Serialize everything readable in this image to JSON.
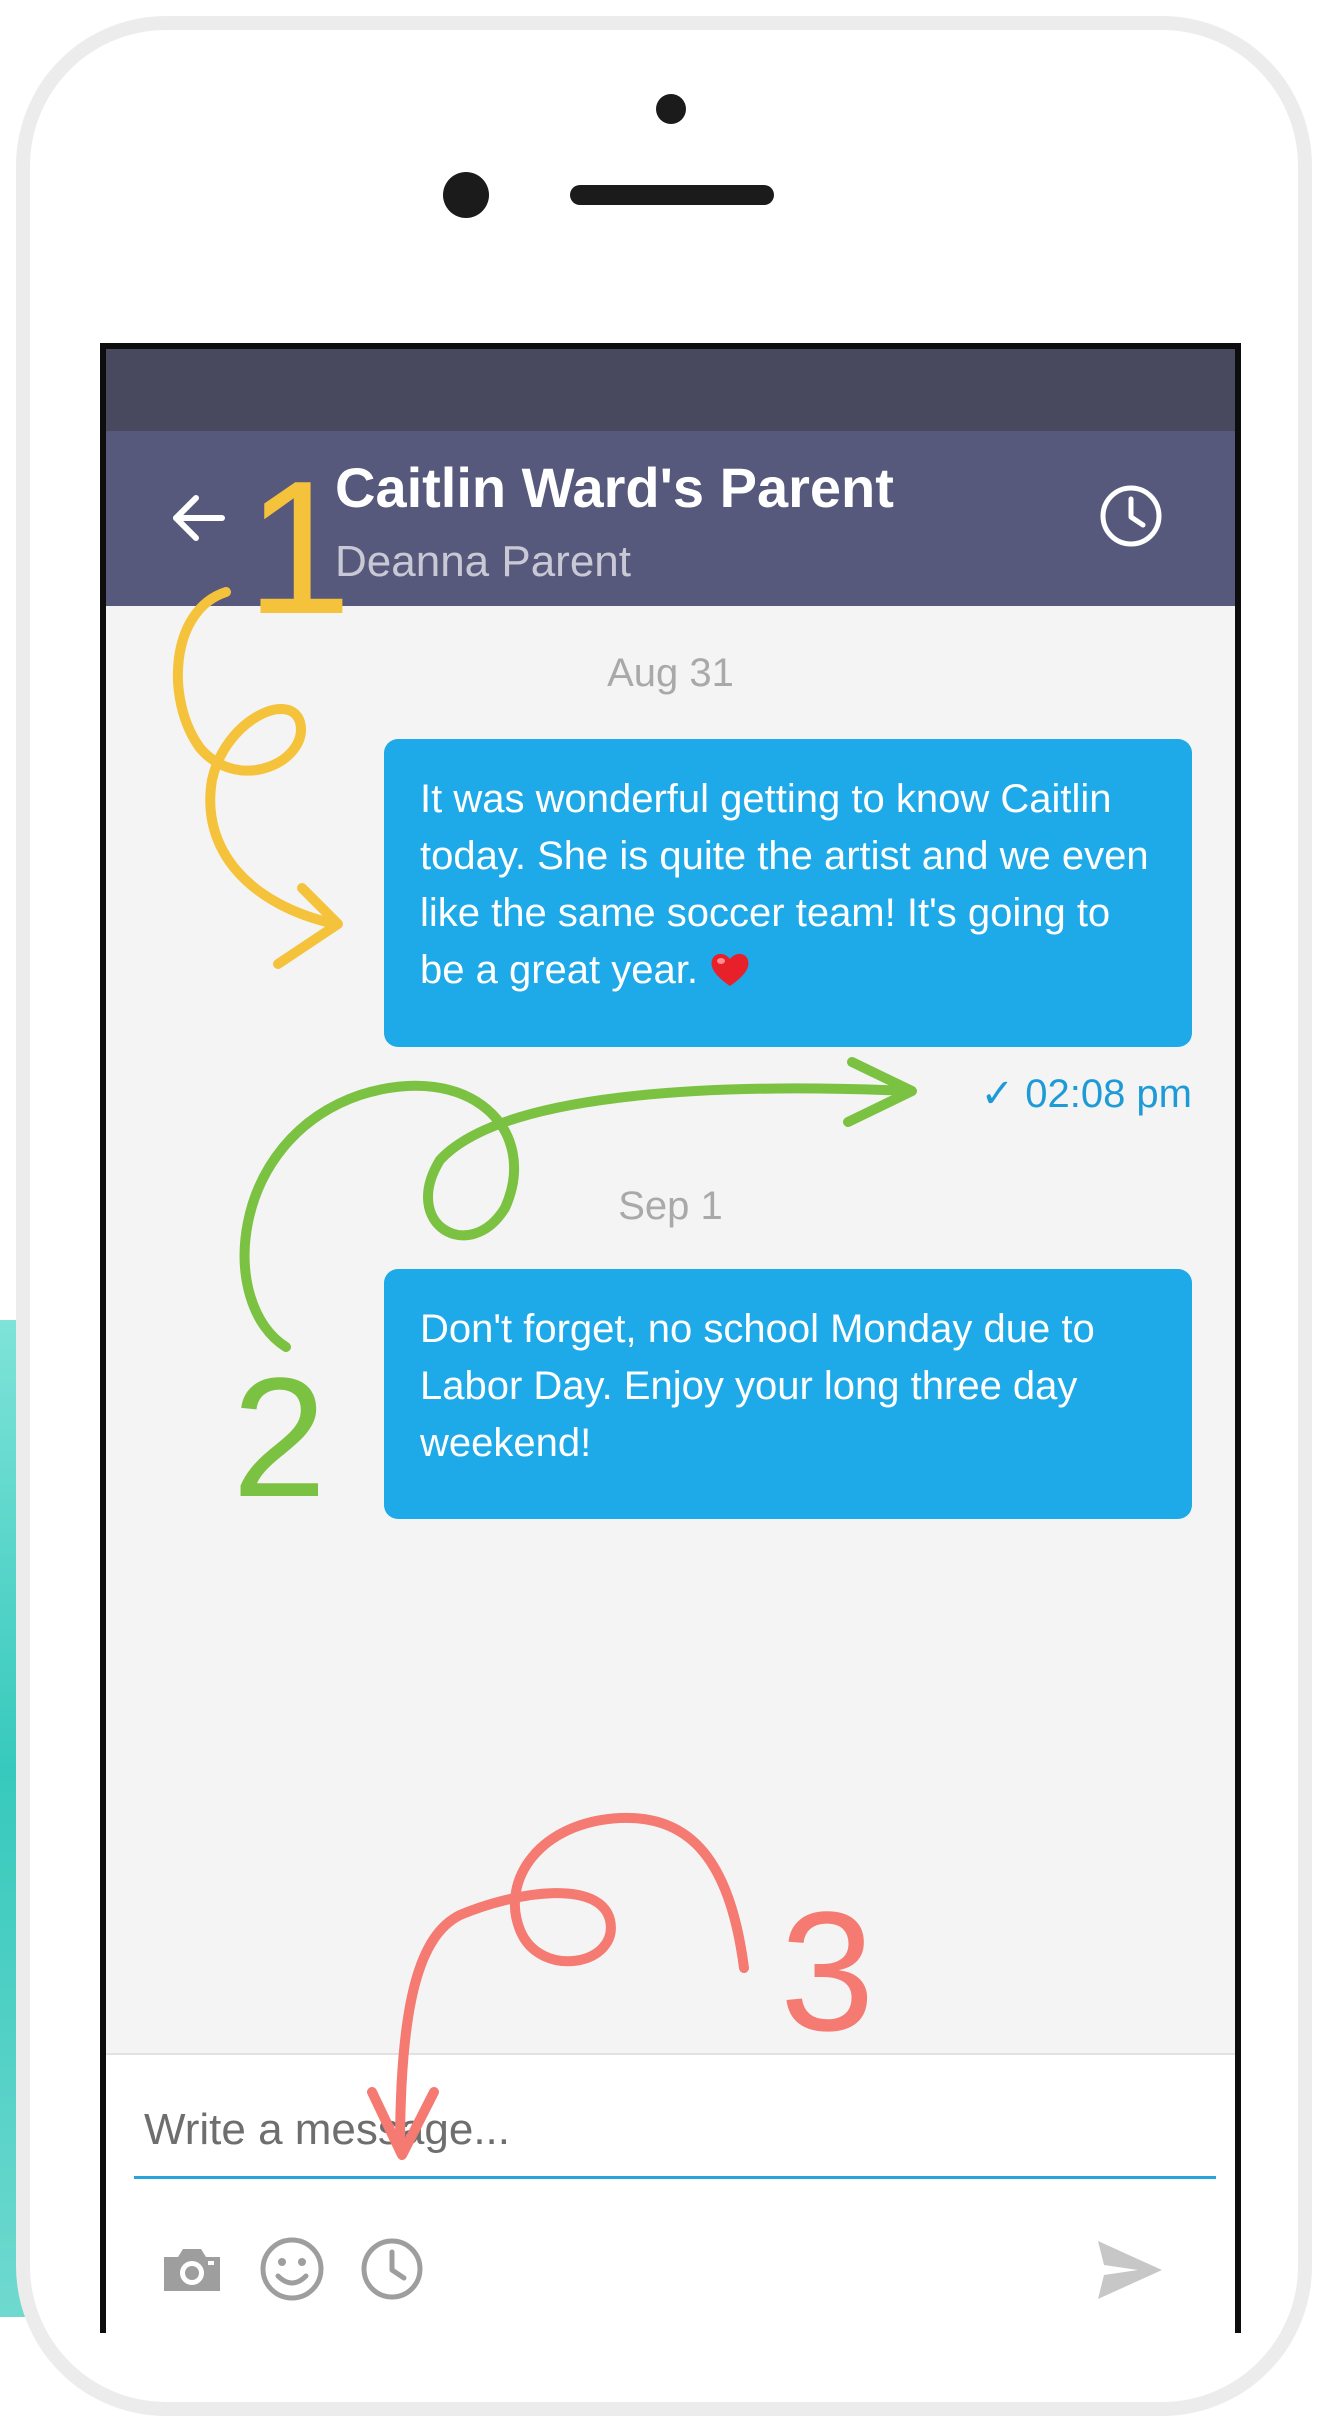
{
  "header": {
    "title": "Caitlin Ward's Parent",
    "subtitle": "Deanna Parent",
    "back_icon": "arrow-left-icon",
    "history_icon": "clock-icon"
  },
  "conversation": {
    "groups": [
      {
        "date": "Aug 31",
        "message": "It was wonderful getting to know Caitlin today. She is quite the artist and we even like the same soccer team! It's going to be a great year.",
        "emoji": "heart-emoji",
        "time": "✓ 02:08 pm"
      },
      {
        "date": "Sep 1",
        "message": "Don't forget, no school Monday due to Labor Day. Enjoy your long three day weekend!"
      }
    ]
  },
  "composer": {
    "placeholder": "Write a message...",
    "tools": [
      "camera-icon",
      "smiley-icon",
      "clock-icon"
    ],
    "send_icon": "send-icon"
  },
  "annotations": {
    "marks": [
      "1",
      "2",
      "3"
    ],
    "colors": {
      "mark_1": "#f5c33b",
      "mark_2": "#7cc242",
      "mark_3": "#f47a72"
    }
  },
  "colors": {
    "status_bar": "#48485f",
    "header": "#56587c",
    "bubble": "#1ea9e8",
    "chat_background": "#f4f4f4",
    "time_text": "#1e9bd7",
    "input_underline": "#29a3dc"
  }
}
